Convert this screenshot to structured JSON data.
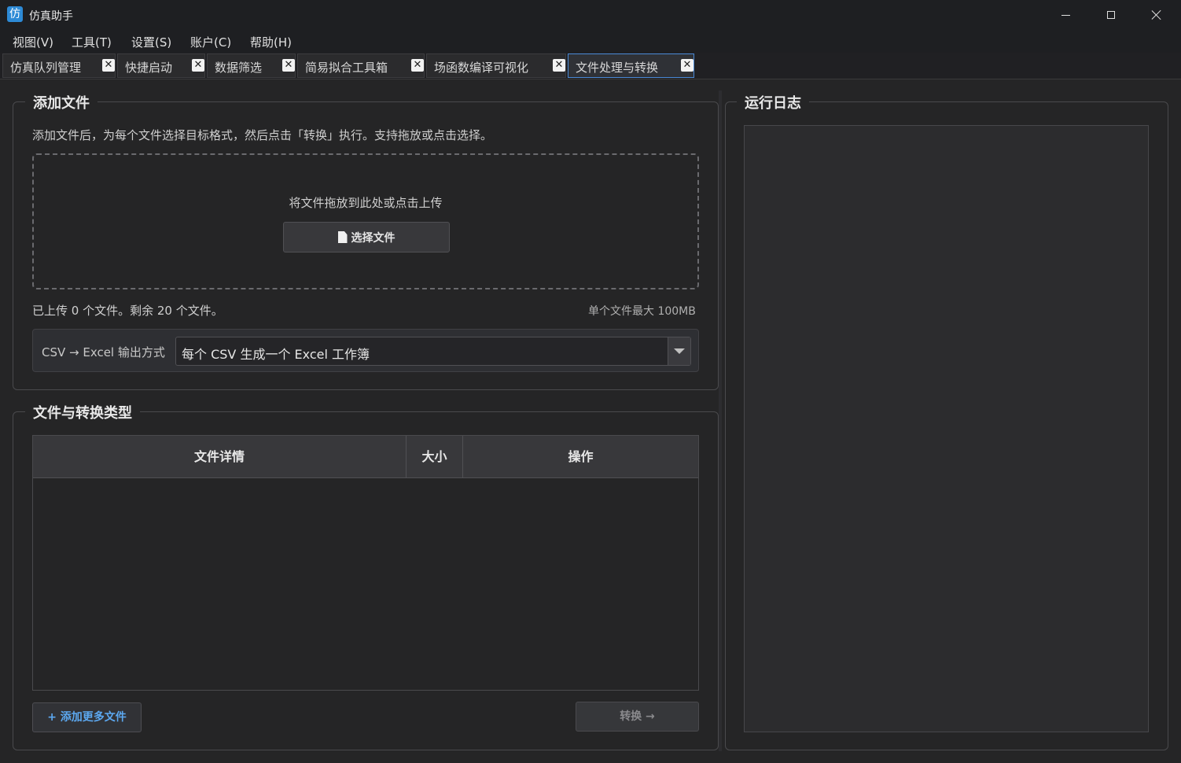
{
  "app": {
    "title": "仿真助手",
    "icon_glyph": "仿"
  },
  "menu": [
    {
      "label": "视图(V)"
    },
    {
      "label": "工具(T)"
    },
    {
      "label": "设置(S)"
    },
    {
      "label": "账户(C)"
    },
    {
      "label": "帮助(H)"
    }
  ],
  "tabs": [
    {
      "label": "仿真队列管理"
    },
    {
      "label": "快捷启动"
    },
    {
      "label": "数据筛选"
    },
    {
      "label": "简易拟合工具箱"
    },
    {
      "label": "场函数编译可视化"
    },
    {
      "label": "文件处理与转换",
      "active": true
    }
  ],
  "tab_close_glyph": "✕",
  "add_files": {
    "title": "添加文件",
    "description": "添加文件后，为每个文件选择目标格式，然后点击「转换」执行。支持拖放或点击选择。",
    "dropzone_text": "将文件拖放到此处或点击上传",
    "select_button": "选择文件",
    "upload_status": "已上传 0 个文件。剩余 20 个文件。",
    "max_size_note": "单个文件最大 100MB",
    "csv_label": "CSV → Excel 输出方式",
    "csv_mode": "每个 CSV 生成一个 Excel 工作簿"
  },
  "files_table": {
    "title": "文件与转换类型",
    "columns": [
      "文件详情",
      "大小",
      "操作"
    ],
    "rows": []
  },
  "actions": {
    "add_more": "+ 添加更多文件",
    "convert": "转换 →"
  },
  "log": {
    "title": "运行日志"
  },
  "colors": {
    "accent": "#4a89d6",
    "link": "#5ca8f0",
    "background": "#252526"
  }
}
